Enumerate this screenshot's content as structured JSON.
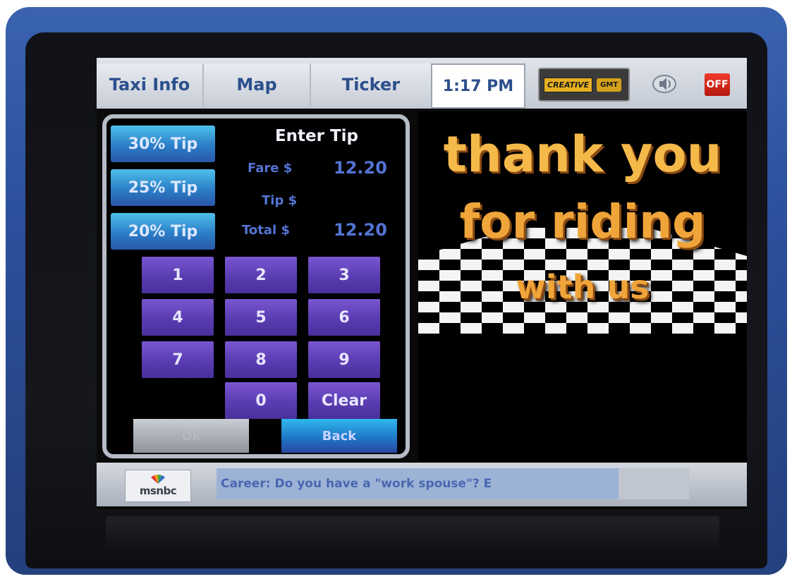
{
  "topbar": {
    "tabs": [
      {
        "label": "Taxi Info"
      },
      {
        "label": "Map"
      },
      {
        "label": "Ticker"
      }
    ],
    "clock": "1:17 PM",
    "logo_text": "CREATIVE",
    "logo_badge": "GMT",
    "off_label": "OFF"
  },
  "tip_panel": {
    "presets": [
      "30% Tip",
      "25% Tip",
      "20% Tip"
    ],
    "title": "Enter Tip",
    "fare_label": "Fare $",
    "fare_value": "12.20",
    "tip_label": "Tip $",
    "tip_value": "",
    "total_label": "Total $",
    "total_value": "12.20",
    "keys": [
      "1",
      "2",
      "3",
      "4",
      "5",
      "6",
      "7",
      "8",
      "9",
      "0",
      "Clear"
    ],
    "ok_label": "Ok",
    "back_label": "Back"
  },
  "ad": {
    "line1": "thank you",
    "line2": "for riding",
    "line3": "with us"
  },
  "ticker": {
    "logo_text": "msnbc",
    "headline": "Career: Do you have a \"work spouse\"?   E"
  },
  "colors": {
    "tab_text": "#2c4f8c",
    "tip_button": "#2b7ec7",
    "keypad": "#5a3cb2",
    "off_button": "#d42a1c",
    "ad_text": "#f0a53a"
  }
}
